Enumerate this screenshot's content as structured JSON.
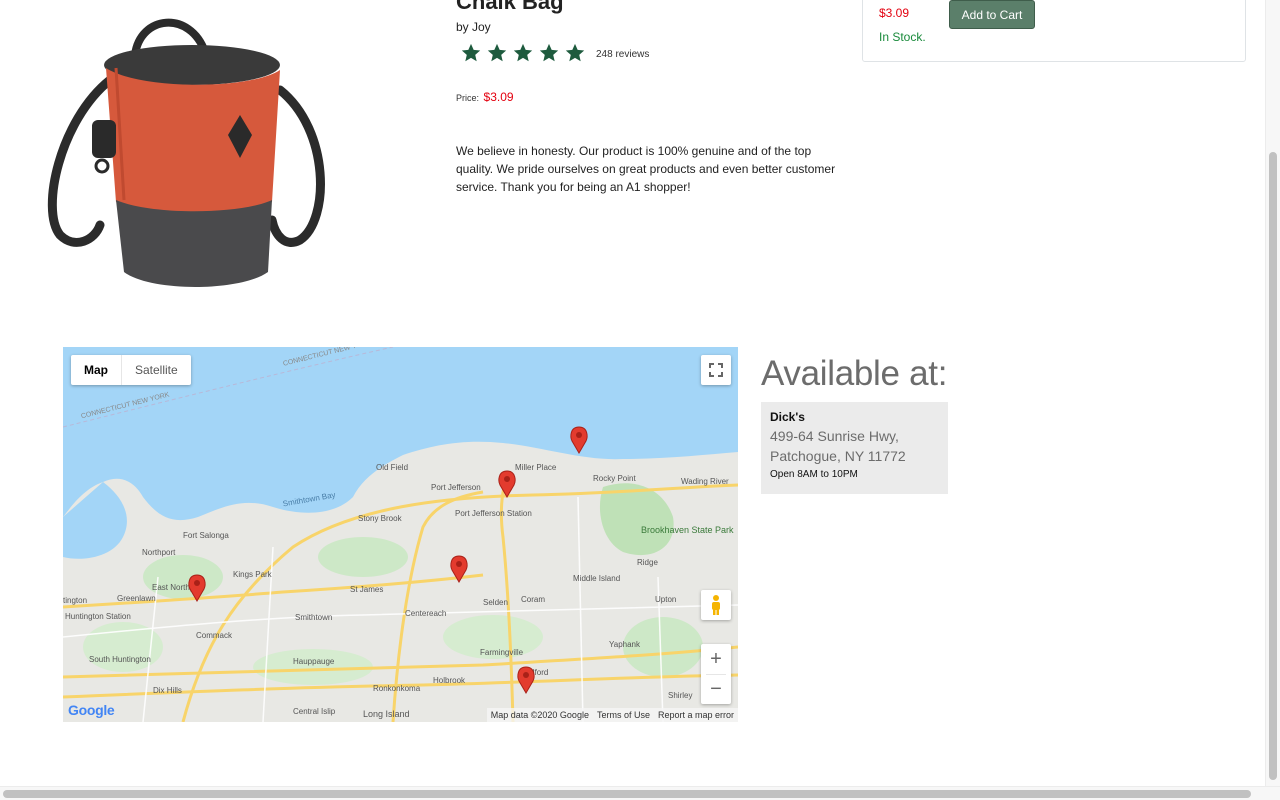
{
  "product": {
    "title": "Chalk Bag",
    "byline": "by Joy",
    "rating": 5,
    "reviews": "248 reviews",
    "price_label": "Price:",
    "price": "$3.09",
    "description": "We believe in honesty. Our product is 100% genuine and of the top quality. We pride ourselves on great products and even better customer service. Thank you for being an A1 shopper!"
  },
  "buy_box": {
    "price": "$3.09",
    "add_to_cart": "Add to Cart",
    "stock": "In Stock."
  },
  "map": {
    "type_map": "Map",
    "type_satellite": "Satellite",
    "zoom_in": "+",
    "zoom_out": "−",
    "google_logo": "Google",
    "map_data": "Map data ©2020 Google",
    "terms": "Terms of Use",
    "report": "Report a map error",
    "labels": {
      "connecticut1": "CONNECTICUT NEW YORK",
      "connecticut2": "CONNECTICUT NEW YORK",
      "smithtown_bay": "Smithtown Bay",
      "old_field": "Old Field",
      "miller_place": "Miller Place",
      "rocky_point": "Rocky Point",
      "wading_river": "Wading River",
      "port_jefferson": "Port Jefferson",
      "port_jefferson_station": "Port Jefferson Station",
      "stony_brook": "Stony Brook",
      "brookhaven": "Brookhaven State Park",
      "fort_salonga": "Fort Salonga",
      "northport": "Northport",
      "kings_park": "Kings Park",
      "east_northport": "East Northport",
      "greenlawn": "Greenlawn",
      "huntington": "tington",
      "huntington_station": "Huntington Station",
      "st_james": "St James",
      "smithtown": "Smithtown",
      "centereach": "Centereach",
      "selden": "Selden",
      "coram": "Coram",
      "middle_island": "Middle Island",
      "ridge": "Ridge",
      "upton": "Upton",
      "commack": "Commack",
      "south_huntington": "South Huntington",
      "hauppauge": "Hauppauge",
      "farmingville": "Farmingville",
      "yaphank": "Yaphank",
      "dix_hills": "Dix Hills",
      "ronkonkoma": "Ronkonkoma",
      "holbrook": "Holbrook",
      "medford": "Medford",
      "shirley": "Shirley",
      "central_islip": "Central Islip",
      "long_island": "Long Island"
    }
  },
  "available": {
    "title": "Available at:",
    "store_name": "Dick's",
    "address_line1": "499-64 Sunrise Hwy,",
    "address_line2": "Patchogue, NY 11772",
    "hours": "Open 8AM to 10PM"
  },
  "colors": {
    "star": "#1e5b3e",
    "price": "#e3000f",
    "stock": "#198a3b",
    "cart_button": "#5b7f6a",
    "water": "#a3d5f7",
    "land": "#e8e8e4",
    "park": "#c9e4c3",
    "highway": "#f8d46a",
    "marker": "#e33b2e"
  }
}
